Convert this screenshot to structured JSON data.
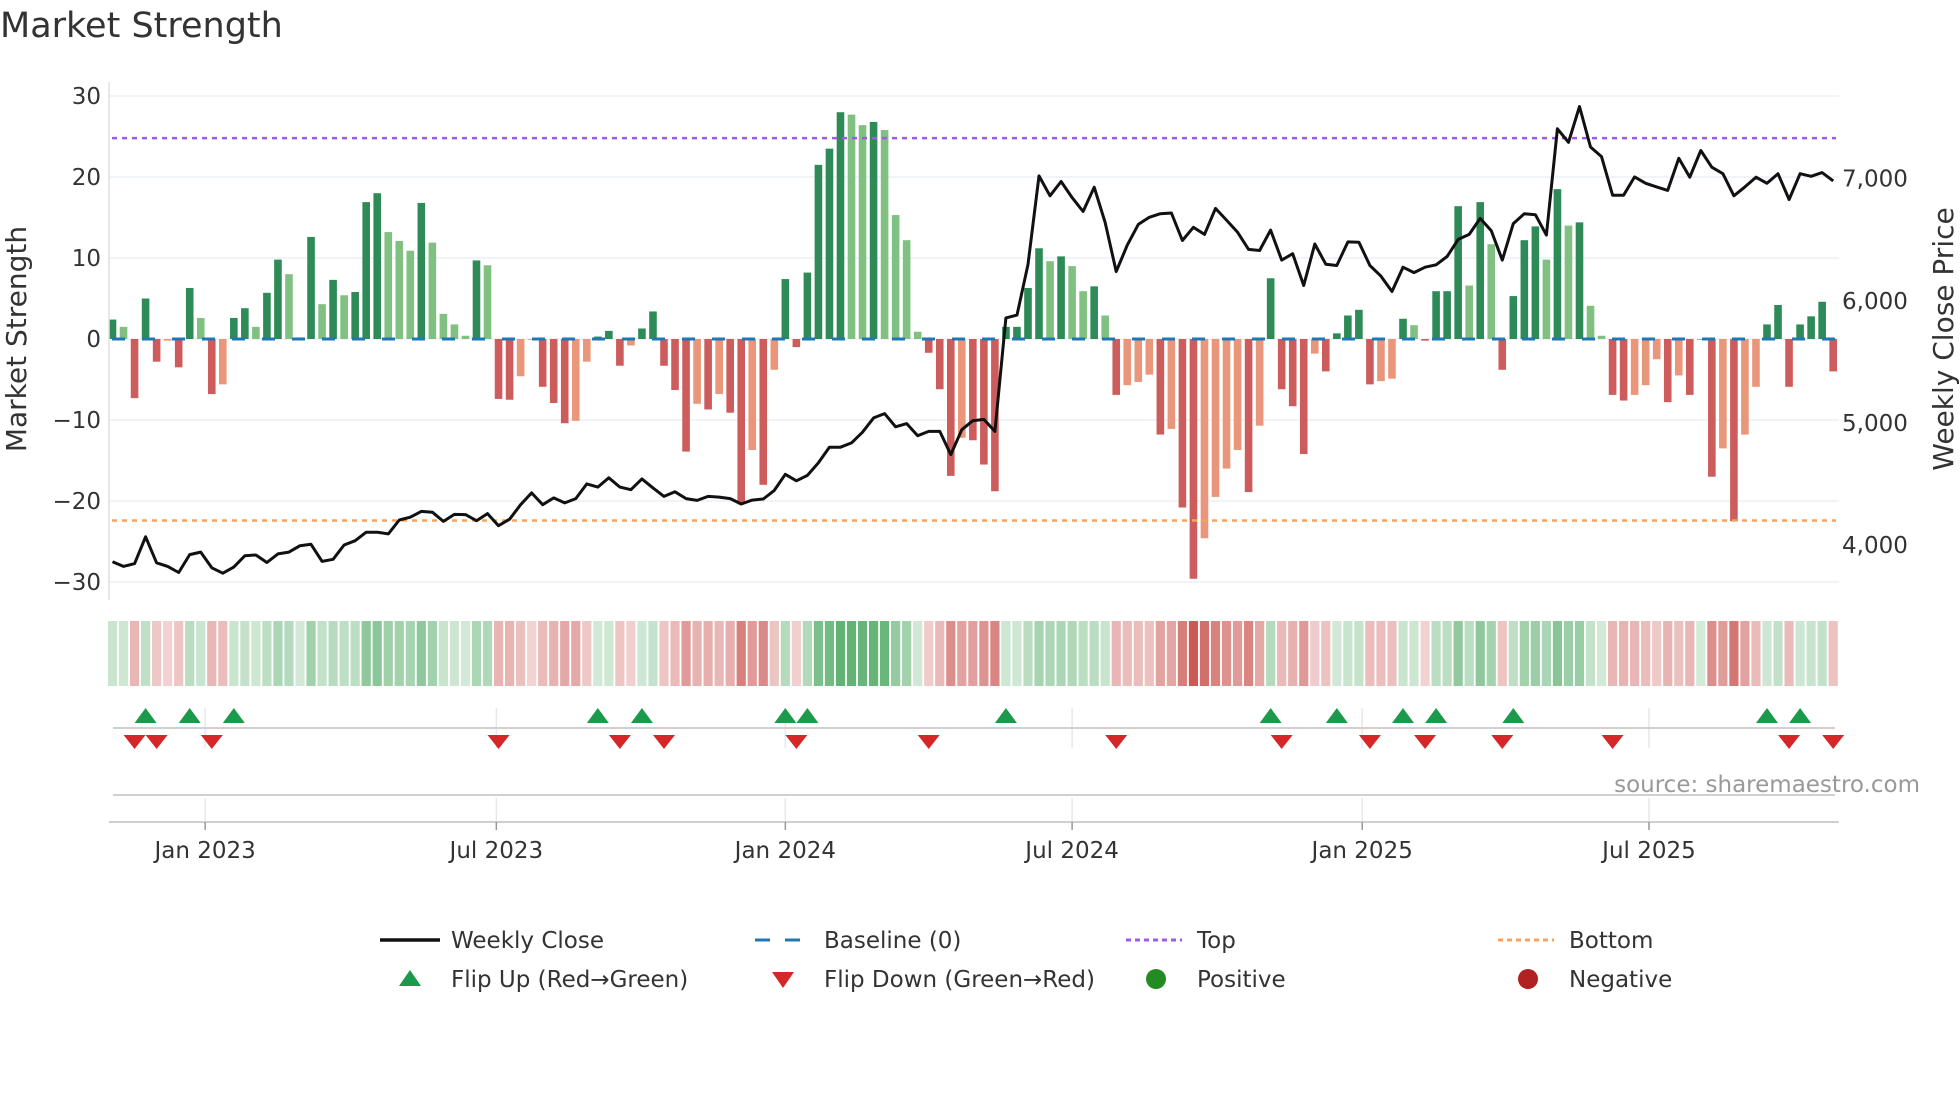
{
  "title": "Market Strength",
  "source": "source: sharemaestro.com",
  "chart_data": {
    "type": "bar+line",
    "title": "Market Strength",
    "ylabel_left": "Market Strength",
    "ylabel_right": "Weekly Close Price",
    "ylim_left": [
      -32,
      32
    ],
    "ylim_right_ticks": [
      4000,
      5000,
      6000,
      7000
    ],
    "left_ticks": [
      {
        "v": 30,
        "label": "30"
      },
      {
        "v": 20,
        "label": "20"
      },
      {
        "v": 10,
        "label": "10"
      },
      {
        "v": 0,
        "label": "0"
      },
      {
        "v": -10,
        "label": "−10"
      },
      {
        "v": -20,
        "label": "−20"
      },
      {
        "v": -30,
        "label": "−30"
      }
    ],
    "right_ticks": [
      {
        "v": 7000,
        "label": "7,000"
      },
      {
        "v": 6000,
        "label": "6,000"
      },
      {
        "v": 5000,
        "label": "5,000"
      },
      {
        "v": 4000,
        "label": "4,000"
      }
    ],
    "x_ticks": [
      {
        "week": 8.4,
        "label": "Jan 2023"
      },
      {
        "week": 34.8,
        "label": "Jul 2023"
      },
      {
        "week": 61.0,
        "label": "Jan 2024"
      },
      {
        "week": 87.0,
        "label": "Jul 2024"
      },
      {
        "week": 113.3,
        "label": "Jan 2025"
      },
      {
        "week": 139.3,
        "label": "Jul 2025"
      }
    ],
    "top_level": 24.8,
    "bottom_level": -22.4,
    "baseline": 0,
    "colors": {
      "up_strong": "#2e8b57",
      "up_weak": "#80c080",
      "down_strong": "#cd5c5c",
      "down_weak": "#e9967a",
      "close": "#111111",
      "baseline": "#1f77b4",
      "top": "#9b5de5",
      "bottom": "#f4a460",
      "flip_up": "#1a9a4a",
      "flip_down": "#d62728",
      "positive": "#228b22",
      "negative": "#b22222"
    },
    "strength": [
      2.4,
      1.5,
      -7.3,
      5.0,
      -2.8,
      -0.2,
      -3.5,
      6.3,
      2.6,
      -6.8,
      -5.6,
      2.6,
      3.8,
      1.5,
      5.7,
      9.8,
      8.0,
      0.2,
      12.6,
      4.3,
      7.3,
      5.4,
      5.8,
      16.9,
      18.0,
      13.2,
      12.1,
      10.9,
      16.8,
      11.9,
      3.1,
      1.8,
      0.4,
      9.7,
      9.1,
      -7.4,
      -7.5,
      -4.6,
      -0.1,
      -5.9,
      -7.9,
      -10.4,
      -10.1,
      -2.8,
      0.3,
      1.0,
      -3.3,
      -0.8,
      1.3,
      3.4,
      -3.3,
      -6.3,
      -13.9,
      -8.0,
      -8.7,
      -6.8,
      -9.1,
      -20.3,
      -13.7,
      -18.0,
      -3.8,
      7.4,
      -1.0,
      8.2,
      21.5,
      23.5,
      28.0,
      27.7,
      26.4,
      26.8,
      25.8,
      15.3,
      12.2,
      0.9,
      -1.7,
      -6.2,
      -16.9,
      -12.2,
      -12.5,
      -15.5,
      -18.8,
      1.5,
      1.5,
      6.3,
      11.2,
      9.6,
      10.2,
      9.0,
      5.9,
      6.5,
      2.9,
      -6.9,
      -5.7,
      -5.3,
      -4.4,
      -11.8,
      -11.1,
      -20.8,
      -29.6,
      -24.6,
      -19.5,
      -16.0,
      -13.7,
      -18.9,
      -10.7,
      7.5,
      -6.2,
      -8.3,
      -14.2,
      -1.8,
      -4.0,
      0.7,
      2.9,
      3.6,
      -5.6,
      -5.2,
      -4.9,
      2.5,
      1.7,
      -0.2,
      5.9,
      5.9,
      16.4,
      6.6,
      16.9,
      11.7,
      -3.8,
      5.3,
      12.2,
      13.9,
      9.8,
      18.5,
      14.0,
      14.4,
      4.1,
      0.4,
      -6.9,
      -7.6,
      -6.9,
      -5.7,
      -2.5,
      -7.8,
      -4.5,
      -6.9,
      0,
      -17.0,
      -13.5,
      -22.5,
      -11.8,
      -5.9,
      1.8,
      4.2,
      -5.9,
      1.8,
      2.8,
      4.6,
      -4.0
    ],
    "weekly_close": [
      3863,
      3825,
      3848,
      4067,
      3854,
      3825,
      3775,
      3921,
      3942,
      3813,
      3769,
      3819,
      3912,
      3918,
      3857,
      3927,
      3942,
      3994,
      4006,
      3866,
      3883,
      4000,
      4035,
      4105,
      4105,
      4091,
      4205,
      4228,
      4275,
      4269,
      4193,
      4251,
      4249,
      4199,
      4257,
      4158,
      4211,
      4330,
      4427,
      4330,
      4386,
      4345,
      4380,
      4500,
      4474,
      4550,
      4474,
      4453,
      4541,
      4468,
      4398,
      4436,
      4380,
      4365,
      4398,
      4392,
      4380,
      4336,
      4368,
      4377,
      4447,
      4579,
      4526,
      4570,
      4673,
      4801,
      4801,
      4836,
      4924,
      5041,
      5076,
      4968,
      4994,
      4895,
      4930,
      4930,
      4740,
      4944,
      5018,
      5029,
      4930,
      5860,
      5883,
      6298,
      7023,
      6860,
      6977,
      6845,
      6731,
      6930,
      6640,
      6240,
      6456,
      6626,
      6684,
      6713,
      6719,
      6494,
      6602,
      6544,
      6757,
      6661,
      6561,
      6421,
      6412,
      6579,
      6333,
      6386,
      6125,
      6465,
      6300,
      6289,
      6482,
      6480,
      6289,
      6202,
      6076,
      6275,
      6231,
      6275,
      6295,
      6363,
      6503,
      6544,
      6675,
      6573,
      6333,
      6632,
      6713,
      6705,
      6538,
      7409,
      7298,
      7591,
      7260,
      7181,
      6865,
      6865,
      7015,
      6962,
      6933,
      6904,
      7167,
      7012,
      7231,
      7094,
      7041,
      6860,
      6933,
      7012,
      6962,
      7041,
      6830,
      7041,
      7020,
      7050,
      6982
    ],
    "flip_up_weeks": [
      3,
      7,
      11,
      44,
      48,
      61,
      63,
      81,
      105,
      111,
      117,
      120,
      127,
      150,
      153
    ],
    "flip_down_weeks": [
      2,
      4,
      9,
      35,
      46,
      50,
      62,
      74,
      91,
      106,
      114,
      119,
      126,
      136,
      152,
      156
    ],
    "legend": {
      "position": "bottom",
      "items": [
        {
          "label": "Weekly Close",
          "kind": "line"
        },
        {
          "label": "Baseline (0)",
          "kind": "dash"
        },
        {
          "label": "Top",
          "kind": "dot-top"
        },
        {
          "label": "Bottom",
          "kind": "dot-bottom"
        },
        {
          "label": "Flip Up (Red→Green)",
          "kind": "tri-up"
        },
        {
          "label": "Flip Down (Green→Red)",
          "kind": "tri-down"
        },
        {
          "label": "Positive",
          "kind": "circle-pos"
        },
        {
          "label": "Negative",
          "kind": "circle-neg"
        }
      ]
    }
  }
}
